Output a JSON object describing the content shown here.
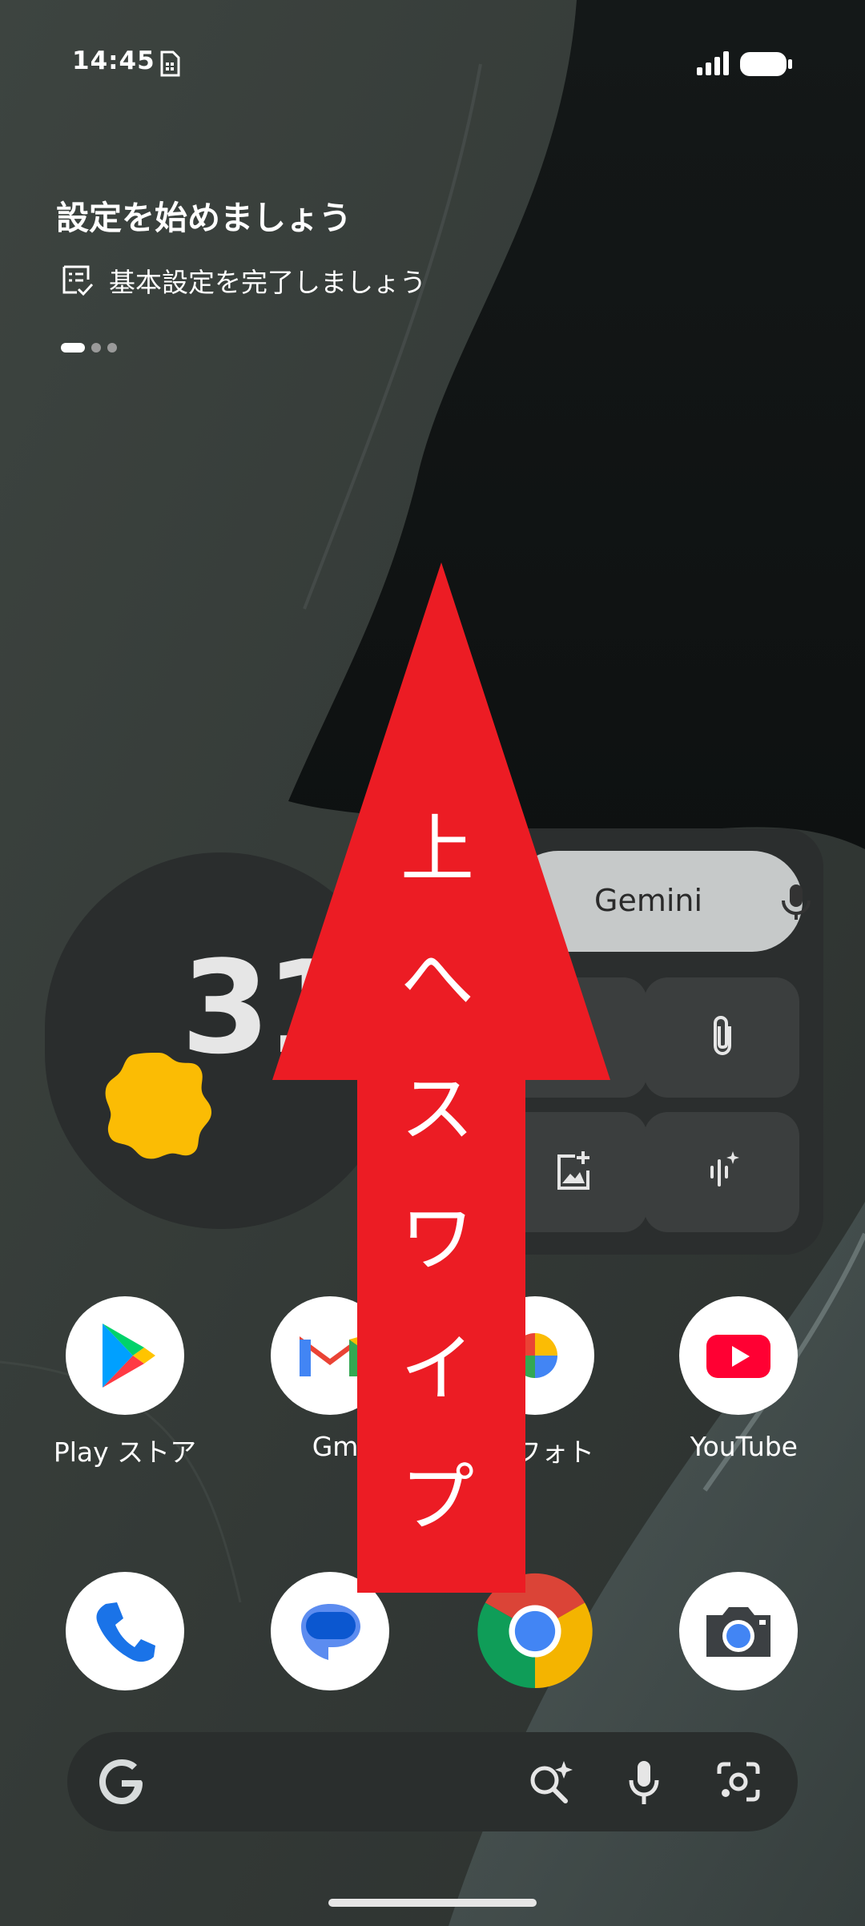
{
  "status_bar": {
    "time": "14:45"
  },
  "setup_card": {
    "title": "設定を始めましょう",
    "item_label": "基本設定を完了しましょう"
  },
  "weather_widget": {
    "temperature": "31°"
  },
  "gemini_widget": {
    "label": "Gemini"
  },
  "apps_row1": [
    {
      "label": "Play ストア",
      "icon": "play-store-icon"
    },
    {
      "label": "Gmail",
      "icon": "gmail-icon"
    },
    {
      "label": "フォト",
      "icon": "photos-icon"
    },
    {
      "label": "YouTube",
      "icon": "youtube-icon"
    }
  ],
  "dock": [
    {
      "icon": "phone-icon"
    },
    {
      "icon": "messages-icon"
    },
    {
      "icon": "chrome-icon"
    },
    {
      "icon": "camera-icon"
    }
  ],
  "overlay": {
    "text": [
      "上",
      "へ",
      "ス",
      "ワ",
      "イ",
      "プ"
    ],
    "color": "#ec1c24"
  },
  "colors": {
    "accent_red": "#ec1c24",
    "sun_yellow": "#fbbc04"
  }
}
